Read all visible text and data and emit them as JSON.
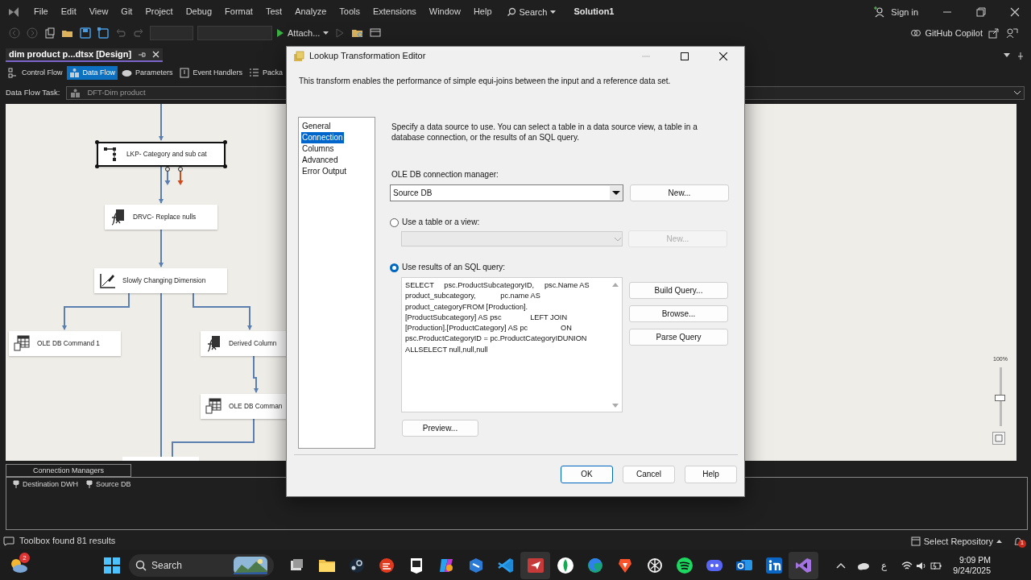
{
  "menu": [
    "File",
    "Edit",
    "View",
    "Git",
    "Project",
    "Debug",
    "Format",
    "Test",
    "Analyze",
    "Tools",
    "Extensions",
    "Window",
    "Help"
  ],
  "search": {
    "label": "Search"
  },
  "solution": "Solution1",
  "sign_in": "Sign in",
  "toolbar": {
    "attach": "Attach..."
  },
  "copilot": "GitHub Copilot",
  "document_tab": {
    "title": "dim product p...dtsx [Design]"
  },
  "designer_tabs": [
    {
      "label": "Control Flow",
      "kind": "control",
      "selected": false
    },
    {
      "label": "Data Flow",
      "kind": "dataflow",
      "selected": true
    },
    {
      "label": "Parameters",
      "kind": "parameters",
      "selected": false
    },
    {
      "label": "Event Handlers",
      "kind": "events",
      "selected": false
    },
    {
      "label": "Packa",
      "kind": "package",
      "selected": false
    }
  ],
  "task": {
    "label": "Data Flow Task:",
    "value": "DFT-Dim product"
  },
  "canvas": {
    "nodes": [
      {
        "label": "LKP- Category and sub cat",
        "kind": "lookup",
        "selected": true
      },
      {
        "label": "DRVC- Replace nulls",
        "kind": "derived",
        "selected": false
      },
      {
        "label": "Slowly Changing Dimension",
        "kind": "scd",
        "selected": false
      },
      {
        "label": "OLE DB Command 1",
        "kind": "command",
        "selected": false
      },
      {
        "label": "Derived Column",
        "kind": "derived",
        "selected": false
      },
      {
        "label": "OLE DB Comman",
        "kind": "command",
        "selected": false
      }
    ],
    "zoom": {
      "reading": "100%",
      "level": 0.48
    }
  },
  "connection_managers": {
    "title": "Connection Managers",
    "items": [
      "Destination DWH",
      "Source DB"
    ]
  },
  "status": {
    "text": "Toolbox found 81 results",
    "repository": "Select Repository",
    "badge": "1"
  },
  "dialog": {
    "title": "Lookup Transformation Editor",
    "description": "This transform enables the performance of simple equi-joins between the input and a reference data set.",
    "pages": [
      {
        "label": "General",
        "selected": false
      },
      {
        "label": "Connection",
        "selected": true
      },
      {
        "label": "Columns",
        "selected": false
      },
      {
        "label": "Advanced",
        "selected": false
      },
      {
        "label": "Error Output",
        "selected": false
      }
    ],
    "instruction": "Specify a data source to use. You can select a table in a data source view, a table in a database connection, or the results of an SQL query.",
    "connection_label": "OLE DB connection manager:",
    "connection_value": "Source DB",
    "new_button": "New...",
    "options": [
      {
        "label": "Use a table or a view:",
        "selected": false
      },
      {
        "label": "Use results of an SQL query:",
        "selected": true
      }
    ],
    "table_new_button": "New...",
    "query_lines": [
      "SELECT     psc.ProductSubcategoryID,     psc.Name AS",
      "product_subcategory,            pc.name AS",
      "product_categoryFROM [Production].",
      "[ProductSubcategory] AS psc              LEFT JOIN",
      "[Production].[ProductCategory] AS pc                ON",
      "psc.ProductCategoryID = pc.ProductCategoryIDUNION",
      "ALLSELECT null,null,null"
    ],
    "query_buttons": [
      "Build Query...",
      "Browse...",
      "Parse Query"
    ],
    "preview_button": "Preview...",
    "footer_buttons": [
      {
        "label": "OK",
        "default": true
      },
      {
        "label": "Cancel",
        "default": false
      },
      {
        "label": "Help",
        "default": false
      }
    ]
  },
  "taskbar": {
    "weather_badge": "2",
    "search": "Search",
    "language": "ع",
    "time": "9:09 PM",
    "date": "9/24/2025"
  }
}
